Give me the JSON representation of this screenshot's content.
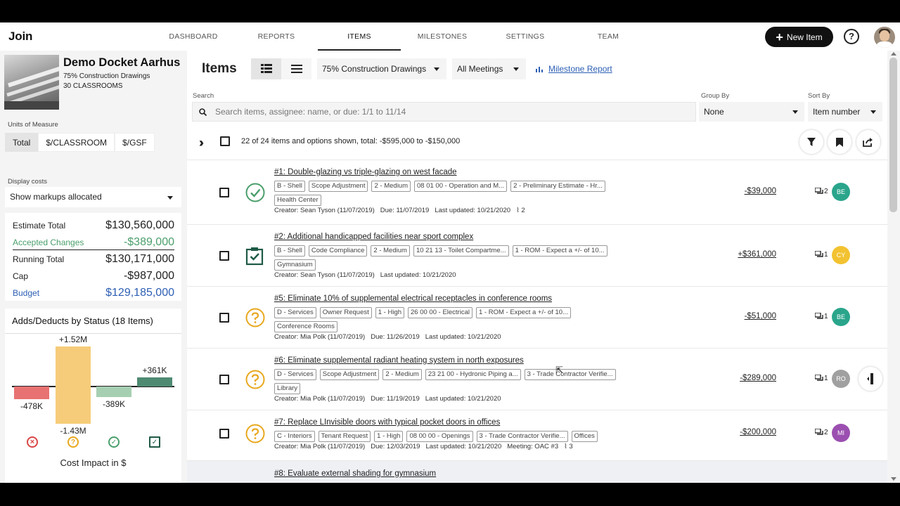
{
  "nav": {
    "logo": "Join",
    "tabs": [
      "DASHBOARD",
      "REPORTS",
      "ITEMS",
      "MILESTONES",
      "SETTINGS",
      "TEAM"
    ],
    "active_tab": "ITEMS",
    "new_item": "New Item"
  },
  "project": {
    "name": "Demo Docket Aarhus",
    "milestone": "75% Construction Drawings",
    "units": "30 CLASSROOMS"
  },
  "sidebar": {
    "uom_label": "Units of Measure",
    "uom_options": [
      "Total",
      "$/CLASSROOM",
      "$/GSF"
    ],
    "uom_selected": "Total",
    "display_costs_label": "Display costs",
    "display_costs_value": "Show markups allocated",
    "totals": [
      {
        "label": "Estimate Total",
        "value": "$130,560,000",
        "color": "#222222"
      },
      {
        "label": "Accepted Changes",
        "value": "-$389,000",
        "color": "#4a9e6b"
      },
      {
        "label": "Running Total",
        "value": "$130,171,000",
        "color": "#222222"
      },
      {
        "label": "Cap",
        "value": "-$987,000",
        "color": "#222222"
      },
      {
        "label": "Budget",
        "value": "$129,185,000",
        "color": "#2d5fb4"
      }
    ],
    "adds_title": "Adds/Deducts by Status (18 Items)",
    "cost_impact_label": "Cost Impact in $"
  },
  "chart_data": {
    "type": "bar",
    "categories": [
      "Rejected",
      "Pending",
      "Accepted",
      "Incorporated"
    ],
    "adds": [
      0,
      1.52,
      0,
      0.361
    ],
    "deducts": [
      -0.478,
      -1.43,
      -0.389,
      0
    ],
    "add_labels": [
      "",
      "+1.52M",
      "",
      "+361K"
    ],
    "deduct_labels": [
      "-478K",
      "-1.43M",
      "-389K",
      ""
    ],
    "colors": [
      "#e87272",
      "#f6cc7a",
      "#a6cfb2",
      "#4e8a72"
    ],
    "xlabel": "Cost Impact in $",
    "ylim": [
      -1.6,
      1.7
    ]
  },
  "main": {
    "title": "Items",
    "milestone_select": "75% Construction Drawings",
    "meetings_select": "All Meetings",
    "milestone_report": "Milestone Report",
    "search_label": "Search",
    "search_placeholder": "Search items, assignee: name, or due: 1/1 to 11/14",
    "group_by_label": "Group By",
    "group_by_value": "None",
    "sort_by_label": "Sort By",
    "sort_by_value": "Item number",
    "summary": "22 of 24 items and options shown, total: -$595,000 to -$150,000"
  },
  "items": [
    {
      "title": "#1: Double-glazing vs triple-glazing on west facade",
      "status": "accepted",
      "chips": [
        "B - Shell",
        "Scope Adjustment",
        "2 - Medium",
        "08 01 00 - Operation and M...",
        "2 - Preliminary Estimate - Hr...",
        "Health Center"
      ],
      "meta": [
        "Creator: Sean Tyson (11/07/2019)",
        "Due: 11/07/2019",
        "Last updated: 10/21/2020"
      ],
      "attachments": "2",
      "amount": "-$39,000",
      "comments": "2",
      "assignee": "BE",
      "assignee_color": "#2aa58b"
    },
    {
      "title": "#2: Additional handicapped facilities near sport complex",
      "status": "incorporated",
      "chips": [
        "B - Shell",
        "Code Compliance",
        "2 - Medium",
        "10 21 13 - Toilet Compartme...",
        "1 - ROM - Expect a +/- of 10...",
        "Gymnasium"
      ],
      "meta": [
        "Creator: Sean Tyson (11/07/2019)",
        "Last updated: 10/21/2020"
      ],
      "attachments": "",
      "amount": "+$361,000",
      "comments": "1",
      "assignee": "CY",
      "assignee_color": "#f2c231"
    },
    {
      "title": "#5: Eliminate 10% of supplemental electrical receptacles in conference rooms",
      "status": "pending",
      "chips": [
        "D - Services",
        "Owner Request",
        "1 - High",
        "26 00 00 - Electrical",
        "1 - ROM - Expect a +/- of 10...",
        "Conference Rooms"
      ],
      "meta": [
        "Creator: Mia Polk (11/07/2019)",
        "Due: 11/26/2019",
        "Last updated: 10/21/2020"
      ],
      "attachments": "",
      "amount": "-$51,000",
      "comments": "1",
      "assignee": "BE",
      "assignee_color": "#2aa58b"
    },
    {
      "title": "#6: Eliminate supplemental radiant heating system in north exposures",
      "status": "pending",
      "chips": [
        "D - Services",
        "Scope Adjustment",
        "2 - Medium",
        "23 21 00 - Hydronic Piping a...",
        "3 - Trade Contractor Verifie...",
        "Library"
      ],
      "meta": [
        "Creator: Mia Polk (11/07/2019)",
        "Due: 11/19/2019",
        "Last updated: 10/21/2020"
      ],
      "attachments": "",
      "amount": "-$289,000",
      "comments": "1",
      "assignee": "RO",
      "assignee_color": "#a0a0a0"
    },
    {
      "title": "#7: Replace LInvisible doors with typical pocket doors in offices",
      "status": "pending",
      "chips": [
        "C - Interiors",
        "Tenant Request",
        "1 - High",
        "08 00 00 - Openings",
        "3 - Trade Contractor Verifie...",
        "Offices"
      ],
      "meta": [
        "Creator: Mia Polk (11/07/2019)",
        "Due: 12/03/2019",
        "Last updated: 10/21/2020",
        "Meeting: OAC #3"
      ],
      "attachments": "3",
      "amount": "-$200,000",
      "comments": "2",
      "assignee": "MI",
      "assignee_color": "#9b4fb0"
    },
    {
      "title": "#8: Evaluate external shading for gymnasium",
      "status": "pending",
      "chips": [],
      "meta": [],
      "attachments": "",
      "amount": "",
      "comments": "",
      "assignee": "",
      "assignee_color": "#ffffff"
    }
  ]
}
